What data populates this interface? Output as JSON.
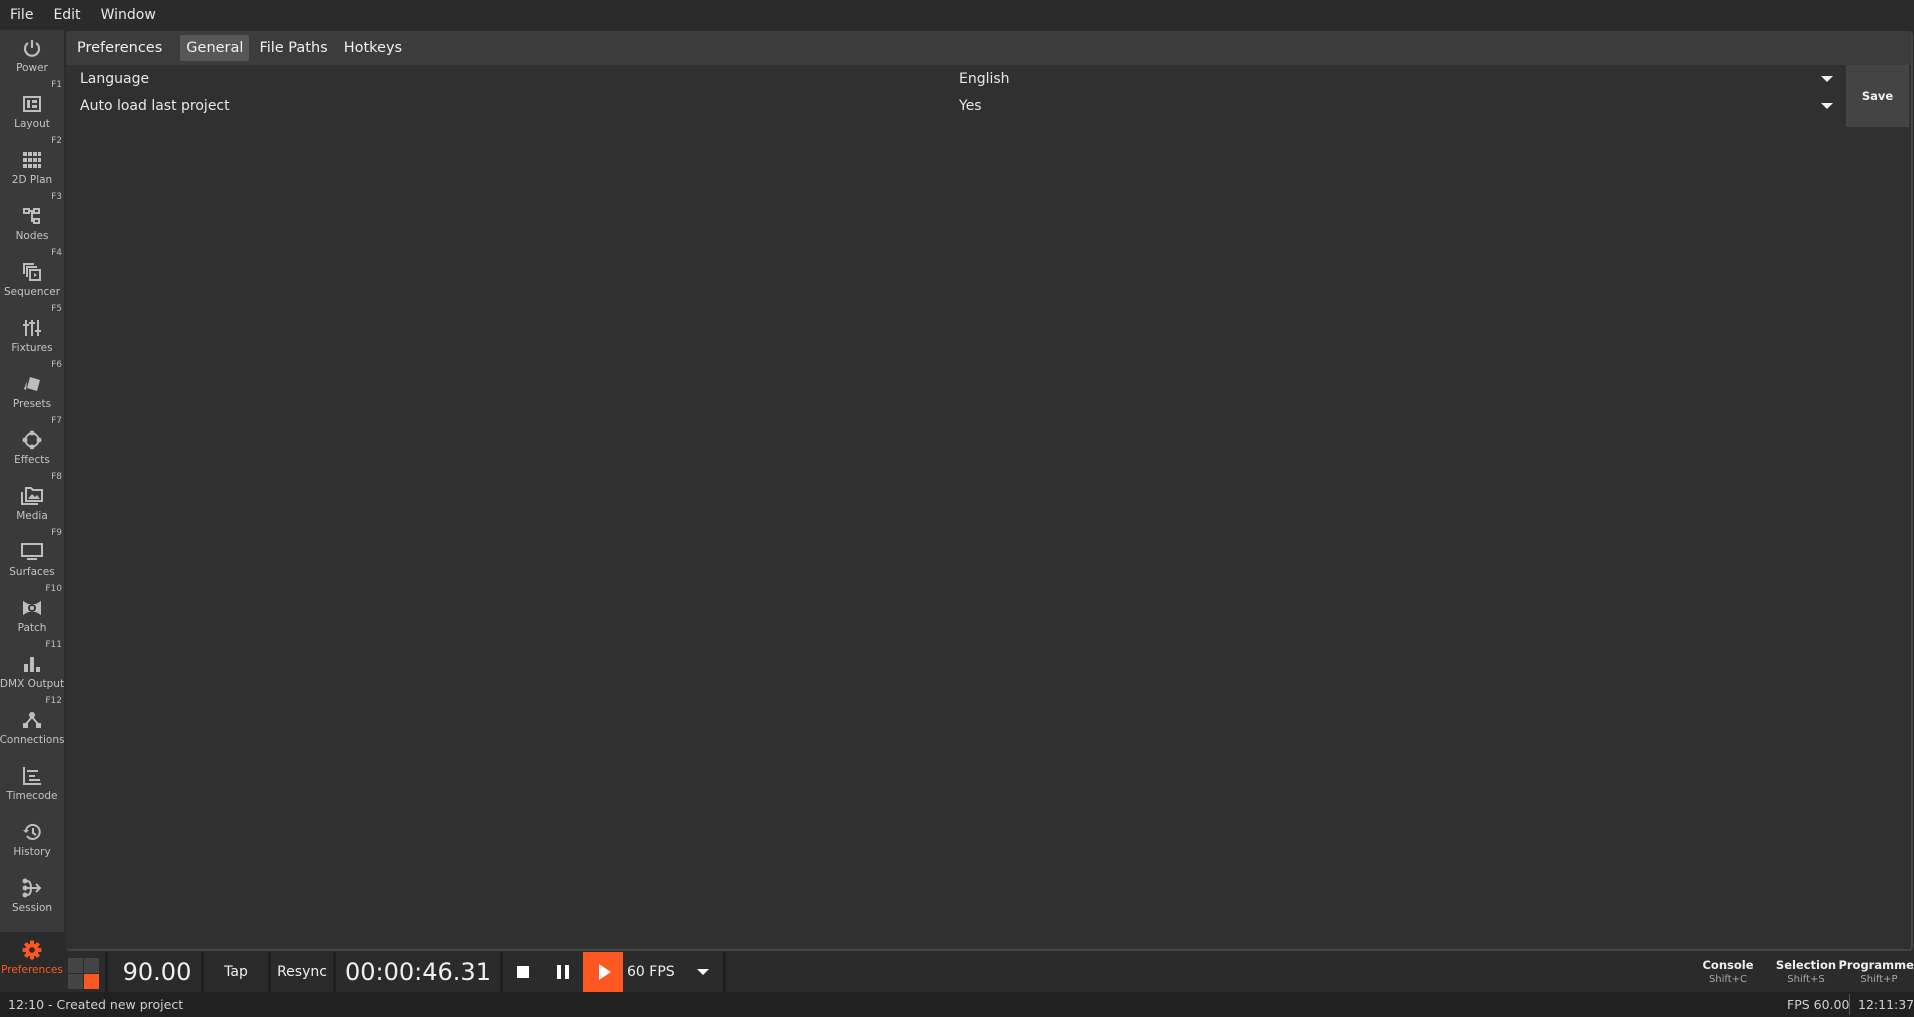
{
  "menubar": {
    "items": [
      "File",
      "Edit",
      "Window"
    ]
  },
  "sidebar": {
    "active_color": "#ff5722",
    "items": [
      {
        "label": "Power",
        "fkey": "",
        "icon": "power-icon"
      },
      {
        "label": "Layout",
        "fkey": "F1",
        "icon": "layout-icon"
      },
      {
        "label": "2D Plan",
        "fkey": "F2",
        "icon": "grid-icon"
      },
      {
        "label": "Nodes",
        "fkey": "F3",
        "icon": "nodes-icon"
      },
      {
        "label": "Sequencer",
        "fkey": "F4",
        "icon": "sequencer-icon"
      },
      {
        "label": "Fixtures",
        "fkey": "F5",
        "icon": "sliders-icon"
      },
      {
        "label": "Presets",
        "fkey": "F6",
        "icon": "presets-icon"
      },
      {
        "label": "Effects",
        "fkey": "F7",
        "icon": "effects-icon"
      },
      {
        "label": "Media",
        "fkey": "F8",
        "icon": "media-icon"
      },
      {
        "label": "Surfaces",
        "fkey": "F9",
        "icon": "monitor-icon"
      },
      {
        "label": "Patch",
        "fkey": "F10",
        "icon": "patch-icon"
      },
      {
        "label": "DMX Output",
        "fkey": "F11",
        "icon": "bar-chart-icon"
      },
      {
        "label": "Connections",
        "fkey": "F12",
        "icon": "connections-icon"
      },
      {
        "label": "Timecode",
        "fkey": "",
        "icon": "timecode-icon"
      },
      {
        "label": "History",
        "fkey": "",
        "icon": "history-icon"
      },
      {
        "label": "Session",
        "fkey": "",
        "icon": "session-icon"
      },
      {
        "label": "Preferences",
        "fkey": "",
        "icon": "gear-icon",
        "active": true
      }
    ]
  },
  "panel": {
    "title": "Preferences",
    "tabs": [
      {
        "label": "General",
        "active": true
      },
      {
        "label": "File Paths",
        "active": false
      },
      {
        "label": "Hotkeys",
        "active": false
      }
    ],
    "settings": [
      {
        "key": "Language",
        "value": "English"
      },
      {
        "key": "Auto load last project",
        "value": "Yes"
      }
    ],
    "save_label": "Save"
  },
  "transport": {
    "bpm": "90.00",
    "tap_label": "Tap",
    "resync_label": "Resync",
    "timecode": "00:00:46.31",
    "fps_select": "60 FPS",
    "play_color": "#ff5722"
  },
  "hints": [
    {
      "title": "Console",
      "shortcut": "Shift+C"
    },
    {
      "title": "Selection",
      "shortcut": "Shift+S"
    },
    {
      "title": "Programmer",
      "shortcut": "Shift+P"
    }
  ],
  "statusbar": {
    "message": "12:10 - Created new project",
    "fps": "FPS 60.00",
    "clock": "12:11:37"
  }
}
